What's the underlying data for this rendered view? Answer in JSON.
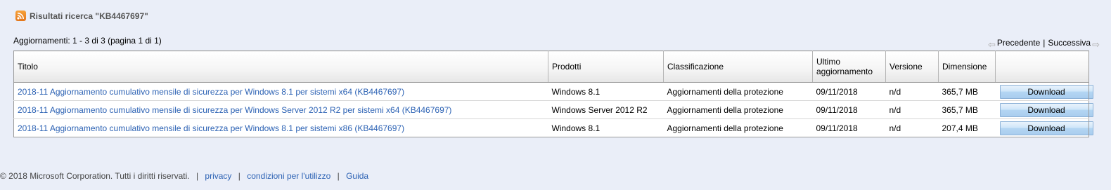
{
  "header": {
    "title": "Risultati ricerca \"KB4467697\""
  },
  "results_count": "Aggiornamenti: 1 - 3 di 3 (pagina 1 di 1)",
  "pager": {
    "prev": "Precedente",
    "separator": "|",
    "next": "Successiva"
  },
  "table": {
    "columns": {
      "title": "Titolo",
      "products": "Prodotti",
      "classification": "Classificazione",
      "last_updated": "Ultimo aggiornamento",
      "version": "Versione",
      "size": "Dimensione"
    },
    "rows": [
      {
        "title": "2018-11 Aggiornamento cumulativo mensile di sicurezza per Windows 8.1 per sistemi x64 (KB4467697)",
        "products": "Windows 8.1",
        "classification": "Aggiornamenti della protezione",
        "last_updated": "09/11/2018",
        "version": "n/d",
        "size": "365,7 MB",
        "download": "Download"
      },
      {
        "title": "2018-11 Aggiornamento cumulativo mensile di sicurezza per Windows Server 2012 R2 per sistemi x64 (KB4467697)",
        "products": "Windows Server 2012 R2",
        "classification": "Aggiornamenti della protezione",
        "last_updated": "09/11/2018",
        "version": "n/d",
        "size": "365,7 MB",
        "download": "Download"
      },
      {
        "title": "2018-11 Aggiornamento cumulativo mensile di sicurezza per Windows 8.1 per sistemi x86 (KB4467697)",
        "products": "Windows 8.1",
        "classification": "Aggiornamenti della protezione",
        "last_updated": "09/11/2018",
        "version": "n/d",
        "size": "207,4 MB",
        "download": "Download"
      }
    ]
  },
  "footer": {
    "copyright": "© 2018 Microsoft Corporation. Tutti i diritti riservati.",
    "privacy": "privacy",
    "terms": "condizioni per l'utilizzo",
    "help": "Guida",
    "separator": "|"
  },
  "colors": {
    "link": "#2c62b4",
    "background": "#eaeef8",
    "rss": "#e3761b"
  },
  "icons": {
    "feed": "rss-icon",
    "prev": "arrow-left-icon",
    "next": "arrow-right-icon"
  }
}
